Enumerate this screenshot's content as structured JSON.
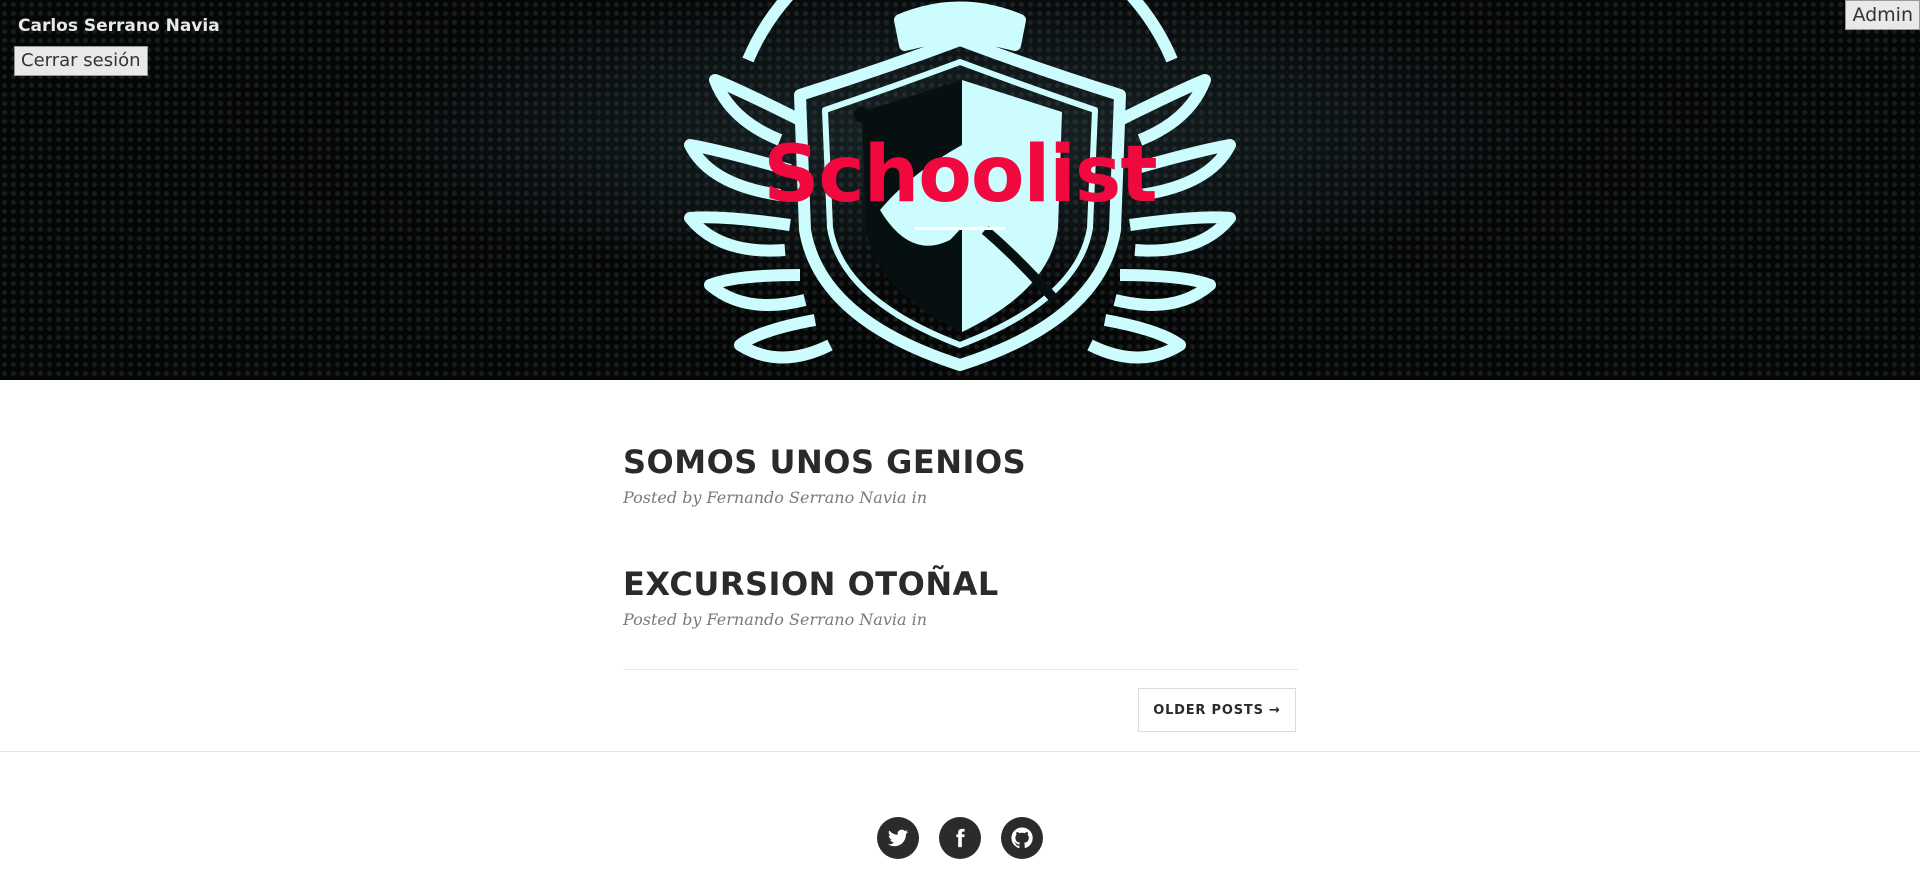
{
  "header": {
    "user_name": "Carlos Serrano Navia",
    "logout_label": "Cerrar sesión",
    "admin_label": "Admin",
    "site_title": "Schoolist",
    "title_color": "#f0083e",
    "crest_color": "#cdfcff"
  },
  "posts": [
    {
      "title": "SOMOS UNOS GENIOS",
      "meta": "Posted by Fernando Serrano Navia in"
    },
    {
      "title": "EXCURSION OTOÑAL",
      "meta": "Posted by Fernando Serrano Navia in"
    }
  ],
  "pager": {
    "older_label": "OLDER POSTS →"
  },
  "footer": {
    "social_icons": [
      "twitter-icon",
      "facebook-icon",
      "github-icon"
    ]
  }
}
